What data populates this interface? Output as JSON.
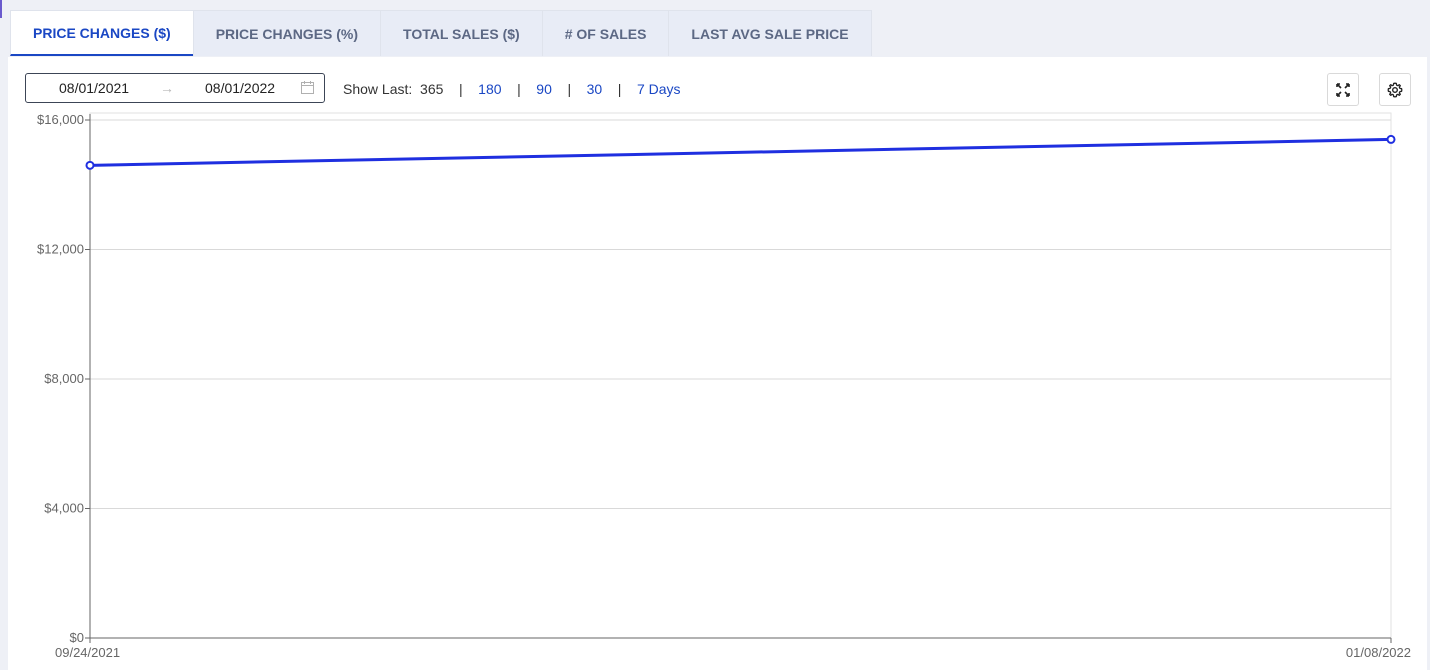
{
  "tabs": [
    {
      "label": "PRICE CHANGES ($)",
      "active": true
    },
    {
      "label": "PRICE CHANGES (%)",
      "active": false
    },
    {
      "label": "TOTAL SALES ($)",
      "active": false
    },
    {
      "label": "# OF SALES",
      "active": false
    },
    {
      "label": "LAST AVG SALE PRICE",
      "active": false
    }
  ],
  "date_range": {
    "start": "08/01/2021",
    "end": "08/01/2022",
    "separator": "→",
    "icon": "calendar-icon"
  },
  "show_last": {
    "label": "Show Last:",
    "current": "365",
    "options": [
      "180",
      "90",
      "30",
      "7 Days"
    ],
    "separator": "|"
  },
  "toolbar": {
    "fullscreen_icon": "fullscreen-icon",
    "settings_icon": "gear-icon"
  },
  "colors": {
    "accent": "#1a47c4",
    "line": "#1f2fe0",
    "grid": "#d9d9d9"
  },
  "chart_data": {
    "type": "line",
    "x": [
      "09/24/2021",
      "01/08/2022"
    ],
    "series": [
      {
        "values": [
          14600,
          15400
        ]
      }
    ],
    "ylim": [
      0,
      16000
    ],
    "yticks": [
      "$0",
      "$4,000",
      "$8,000",
      "$12,000",
      "$16,000"
    ],
    "ytick_values": [
      0,
      4000,
      8000,
      12000,
      16000
    ],
    "xtick_labels": [
      "09/24/2021",
      "01/08/2022"
    ],
    "grid": true,
    "title": "",
    "xlabel": "",
    "ylabel": ""
  }
}
